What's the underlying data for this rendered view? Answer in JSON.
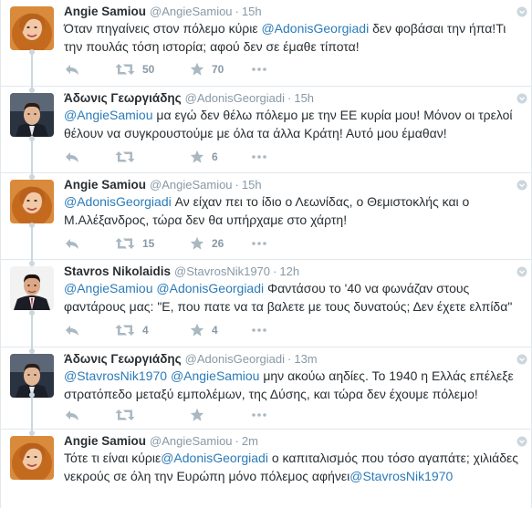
{
  "tweets": [
    {
      "fullname": "Angie Samiou",
      "username": "@AngieSamiou",
      "time": "15h",
      "text_parts": [
        {
          "t": "Όταν πηγαίνεις στον πόλεμο κύριε ",
          "m": false
        },
        {
          "t": "@AdonisGeorgiadi",
          "m": true
        },
        {
          "t": " δεν φοβάσαι την ήπα!Τι την πουλάς τόση ιστορία; αφού δεν σε έμαθε τίποτα!",
          "m": false
        }
      ],
      "retweets": "50",
      "favorites": "70",
      "avatar": "angie"
    },
    {
      "fullname": "Άδωνις Γεωργιάδης",
      "username": "@AdonisGeorgiadi",
      "time": "15h",
      "text_parts": [
        {
          "t": "@AngieSamiou",
          "m": true
        },
        {
          "t": " μα εγώ δεν θέλω πόλεμο με την ΕΕ κυρία μου! Μόνον οι τρελοί θέλουν να συγκρουστούμε με όλα τα άλλα Κράτη! Αυτό μου έμαθαν!",
          "m": false
        }
      ],
      "retweets": "",
      "favorites": "6",
      "avatar": "adonis"
    },
    {
      "fullname": "Angie Samiou",
      "username": "@AngieSamiou",
      "time": "15h",
      "text_parts": [
        {
          "t": "@AdonisGeorgiadi",
          "m": true
        },
        {
          "t": " Αν είχαν πει το ίδιο ο Λεωνίδας, ο Θεμιστοκλής και ο Μ.Αλέξανδρος, τώρα δεν θα υπήρχαμε στο χάρτη!",
          "m": false
        }
      ],
      "retweets": "15",
      "favorites": "26",
      "avatar": "angie"
    },
    {
      "fullname": "Stavros Nikolaidis",
      "username": "@StavrosNik1970",
      "time": "12h",
      "text_parts": [
        {
          "t": "@AngieSamiou",
          "m": true
        },
        {
          "t": " ",
          "m": false
        },
        {
          "t": "@AdonisGeorgiadi",
          "m": true
        },
        {
          "t": " Φαντάσου το '40 να φωνάζαν στους φαντάρους μας: \"Ε, που πατε να τα βαλετε με τους δυνατούς; Δεν έχετε ελπίδα\"",
          "m": false
        }
      ],
      "retweets": "4",
      "favorites": "4",
      "avatar": "stavros"
    },
    {
      "fullname": "Άδωνις Γεωργιάδης",
      "username": "@AdonisGeorgiadi",
      "time": "13m",
      "text_parts": [
        {
          "t": "@StavrosNik1970",
          "m": true
        },
        {
          "t": " ",
          "m": false
        },
        {
          "t": "@AngieSamiou",
          "m": true
        },
        {
          "t": " μην ακούω αηδίες. Το 1940 η Ελλάς επέλεξε στρατόπεδο μεταξύ εμπολέμων, της Δύσης, και τώρα δεν έχουμε πόλεμο!",
          "m": false
        }
      ],
      "retweets": "",
      "favorites": "",
      "avatar": "adonis"
    },
    {
      "fullname": "Angie Samiou",
      "username": "@AngieSamiou",
      "time": "2m",
      "text_parts": [
        {
          "t": "Τότε τι είναι κύριε",
          "m": false
        },
        {
          "t": "@AdonisGeorgiadi",
          "m": true
        },
        {
          "t": " ο καπιταλισμός που τόσο αγαπάτε; χιλιάδες νεκρούς σε όλη την Ευρώπη μόνο πόλεμος αφήνει",
          "m": false
        },
        {
          "t": "@StavrosNik1970",
          "m": true
        }
      ],
      "retweets": "",
      "favorites": "",
      "avatar": "angie"
    }
  ],
  "colors": {
    "link": "#2b7bb9",
    "muted": "#8899a6",
    "text": "#292f33",
    "icon": "#aab8c2"
  }
}
